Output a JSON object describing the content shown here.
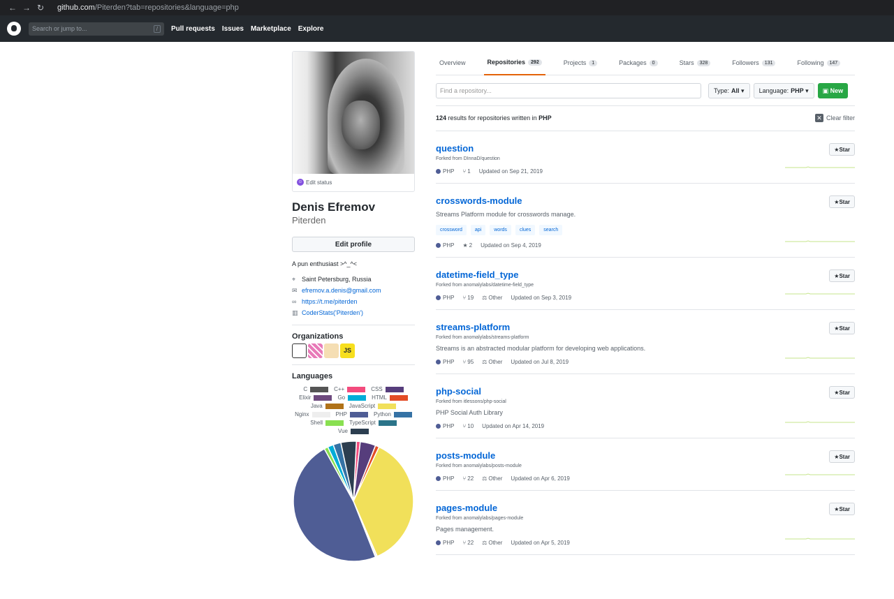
{
  "browser": {
    "url_host": "github.com",
    "url_path": "/Piterden?tab=repositories&language=php"
  },
  "header": {
    "search_placeholder": "Search or jump to...",
    "slash": "/",
    "nav": [
      "Pull requests",
      "Issues",
      "Marketplace",
      "Explore"
    ]
  },
  "profile": {
    "edit_status": "Edit status",
    "name": "Denis Efremov",
    "login": "Piterden",
    "edit_profile": "Edit profile",
    "bio": "A pun enthusiast >^_^<",
    "location": "Saint Petersburg, Russia",
    "email": "efremov.a.denis@gmail.com",
    "website": "https://t.me/piterden",
    "stats": "CoderStats('Piterden')"
  },
  "organizations": {
    "title": "Organizations",
    "js_label": "JS"
  },
  "languages": {
    "title": "Languages",
    "items": [
      {
        "name": "C",
        "color": "#555555"
      },
      {
        "name": "C++",
        "color": "#f34b7d"
      },
      {
        "name": "CSS",
        "color": "#563d7c"
      },
      {
        "name": "Elixir",
        "color": "#6e4a7e"
      },
      {
        "name": "Go",
        "color": "#00ADD8"
      },
      {
        "name": "HTML",
        "color": "#e34c26"
      },
      {
        "name": "Java",
        "color": "#b07219"
      },
      {
        "name": "JavaScript",
        "color": "#f1e05a"
      },
      {
        "name": "Nginx",
        "color": "#eeeeee"
      },
      {
        "name": "PHP",
        "color": "#4F5D95"
      },
      {
        "name": "Python",
        "color": "#3572A5"
      },
      {
        "name": "Shell",
        "color": "#89e051"
      },
      {
        "name": "TypeScript",
        "color": "#2b7489"
      },
      {
        "name": "Vue",
        "color": "#2c3e50"
      }
    ]
  },
  "chart_data": {
    "type": "pie",
    "categories": [
      "C++",
      "CSS",
      "HTML",
      "JavaScript",
      "Nginx",
      "PHP",
      "Shell",
      "Go",
      "Python",
      "Vue"
    ],
    "values": [
      1,
      4,
      1,
      35,
      0.5,
      46,
      1,
      1.5,
      2,
      4
    ]
  },
  "tabs": [
    {
      "label": "Overview",
      "count": ""
    },
    {
      "label": "Repositories",
      "count": "292"
    },
    {
      "label": "Projects",
      "count": "1"
    },
    {
      "label": "Packages",
      "count": "0"
    },
    {
      "label": "Stars",
      "count": "328"
    },
    {
      "label": "Followers",
      "count": "131"
    },
    {
      "label": "Following",
      "count": "147"
    }
  ],
  "filters": {
    "find_placeholder": "Find a repository...",
    "type_label": "Type:",
    "type_value": "All",
    "lang_label": "Language:",
    "lang_value": "PHP",
    "new": "New"
  },
  "results": {
    "count": "124",
    "text": "results for repositories written in",
    "lang": "PHP",
    "clear": "Clear filter"
  },
  "star_label": "Star",
  "repos": [
    {
      "name": "question",
      "fork": "Forked from DInnaD/question",
      "desc": "",
      "topics": [],
      "lang": "PHP",
      "stat_icon": "fork",
      "stat": "1",
      "license": "",
      "updated": "Updated on Sep 21, 2019"
    },
    {
      "name": "crosswords-module",
      "fork": "",
      "desc": "Streams Platform module for crosswords manage.",
      "topics": [
        "crossword",
        "api",
        "words",
        "clues",
        "search"
      ],
      "lang": "PHP",
      "stat_icon": "star",
      "stat": "2",
      "license": "",
      "updated": "Updated on Sep 4, 2019"
    },
    {
      "name": "datetime-field_type",
      "fork": "Forked from anomalylabs/datetime-field_type",
      "desc": "",
      "topics": [],
      "lang": "PHP",
      "stat_icon": "fork",
      "stat": "19",
      "license": "Other",
      "updated": "Updated on Sep 3, 2019"
    },
    {
      "name": "streams-platform",
      "fork": "Forked from anomalylabs/streams-platform",
      "desc": "Streams is an abstracted modular platform for developing web applications.",
      "topics": [],
      "lang": "PHP",
      "stat_icon": "fork",
      "stat": "95",
      "license": "Other",
      "updated": "Updated on Jul 8, 2019"
    },
    {
      "name": "php-social",
      "fork": "Forked from itlessons/php-social",
      "desc": "PHP Social Auth Library",
      "topics": [],
      "lang": "PHP",
      "stat_icon": "fork",
      "stat": "10",
      "license": "",
      "updated": "Updated on Apr 14, 2019"
    },
    {
      "name": "posts-module",
      "fork": "Forked from anomalylabs/posts-module",
      "desc": "",
      "topics": [],
      "lang": "PHP",
      "stat_icon": "fork",
      "stat": "22",
      "license": "Other",
      "updated": "Updated on Apr 6, 2019"
    },
    {
      "name": "pages-module",
      "fork": "Forked from anomalylabs/pages-module",
      "desc": "Pages management.",
      "topics": [],
      "lang": "PHP",
      "stat_icon": "fork",
      "stat": "22",
      "license": "Other",
      "updated": "Updated on Apr 5, 2019"
    }
  ]
}
